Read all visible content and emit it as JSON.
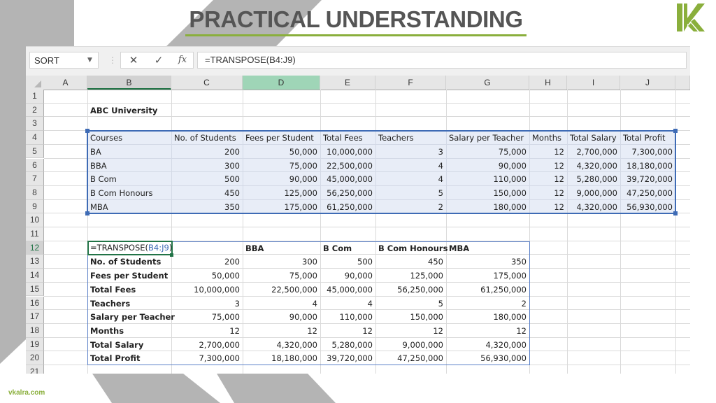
{
  "slide": {
    "title": "PRACTICAL UNDERSTANDING",
    "footer": "vkalra.com",
    "logo_icon": "vk-logo-icon",
    "accent_color": "#8aaf3c",
    "title_color": "#555555",
    "decoration_color": "#b4b4b4"
  },
  "excel": {
    "name_box": "SORT",
    "formula_buttons": {
      "cancel": "✕",
      "enter": "✓",
      "fx": "fx"
    },
    "formula": "=TRANSPOSE(B4:J9)",
    "columns": [
      "A",
      "B",
      "C",
      "D",
      "E",
      "F",
      "G",
      "H",
      "I",
      "J"
    ],
    "rows": [
      "1",
      "2",
      "3",
      "4",
      "5",
      "6",
      "7",
      "8",
      "9",
      "10",
      "11",
      "12",
      "13",
      "14",
      "15",
      "16",
      "17",
      "18",
      "19",
      "20",
      "21"
    ],
    "selected_column": "B",
    "highlighted_column": "D",
    "active_row": "12",
    "active_cell": "B12",
    "sheet_title": "ABC University",
    "source_table": {
      "range": "B4:J9",
      "headers": [
        "Courses",
        "No. of Students",
        "Fees per Student",
        "Total Fees",
        "Teachers",
        "Salary per Teacher",
        "Months",
        "Total Salary",
        "Total Profit"
      ],
      "rows": [
        [
          "BA",
          "200",
          "50,000",
          "10,000,000",
          "3",
          "75,000",
          "12",
          "2,700,000",
          "7,300,000"
        ],
        [
          "BBA",
          "300",
          "75,000",
          "22,500,000",
          "4",
          "90,000",
          "12",
          "4,320,000",
          "18,180,000"
        ],
        [
          "B Com",
          "500",
          "90,000",
          "45,000,000",
          "4",
          "110,000",
          "12",
          "5,280,000",
          "39,720,000"
        ],
        [
          "B Com Honours",
          "450",
          "125,000",
          "56,250,000",
          "5",
          "150,000",
          "12",
          "9,000,000",
          "47,250,000"
        ],
        [
          "MBA",
          "350",
          "175,000",
          "61,250,000",
          "2",
          "180,000",
          "12",
          "4,320,000",
          "56,930,000"
        ]
      ]
    },
    "transposed_table": {
      "range": "B12:G20",
      "editing_formula_prefix": "=TRANSPOSE(",
      "editing_formula_ref": "B4:J9",
      "editing_formula_suffix": ")",
      "header_row": [
        "",
        "",
        "BBA",
        "B Com",
        "B Com Honours",
        "MBA"
      ],
      "rows": [
        [
          "No. of Students",
          "200",
          "300",
          "500",
          "450",
          "350"
        ],
        [
          "Fees per Student",
          "50,000",
          "75,000",
          "90,000",
          "125,000",
          "175,000"
        ],
        [
          "Total Fees",
          "10,000,000",
          "22,500,000",
          "45,000,000",
          "56,250,000",
          "61,250,000"
        ],
        [
          "Teachers",
          "3",
          "4",
          "4",
          "5",
          "2"
        ],
        [
          "Salary per Teacher",
          "75,000",
          "90,000",
          "110,000",
          "150,000",
          "180,000"
        ],
        [
          "Months",
          "12",
          "12",
          "12",
          "12",
          "12"
        ],
        [
          "Total Salary",
          "2,700,000",
          "4,320,000",
          "5,280,000",
          "9,000,000",
          "4,320,000"
        ],
        [
          "Total Profit",
          "7,300,000",
          "18,180,000",
          "39,720,000",
          "47,250,000",
          "56,930,000"
        ]
      ]
    }
  }
}
